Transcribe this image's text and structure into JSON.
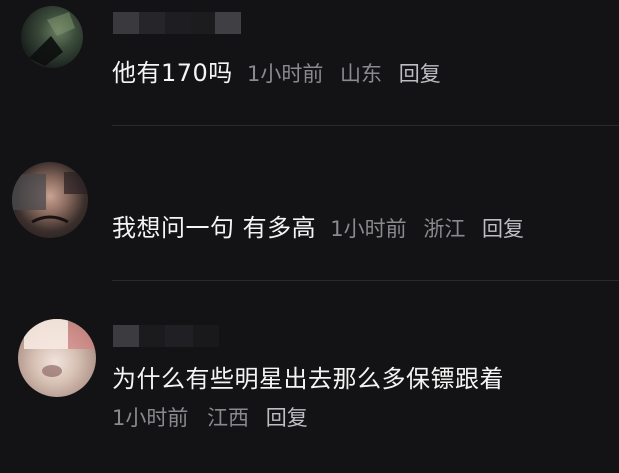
{
  "comments": [
    {
      "text": "他有170吗",
      "time": "1小时前",
      "location": "山东",
      "reply_label": "回复"
    },
    {
      "text": "我想问一句 有多高",
      "time": "1小时前",
      "location": "浙江",
      "reply_label": "回复"
    },
    {
      "text": "为什么有些明星出去那么多保镖跟着",
      "time": "1小时前",
      "location": "江西",
      "reply_label": "回复"
    }
  ],
  "colors": {
    "background": "#131315",
    "text": "#f4f4f4",
    "meta": "#8a8a8e"
  }
}
